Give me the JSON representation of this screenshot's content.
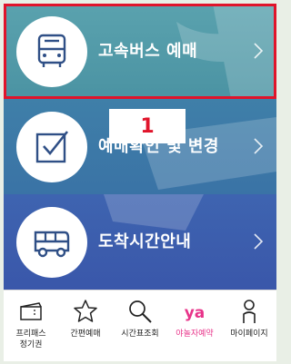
{
  "menu": {
    "items": [
      {
        "label": "고속버스 예매",
        "icon": "bus-icon"
      },
      {
        "label": "예매확인 및 변경",
        "icon": "checkbox-icon"
      },
      {
        "label": "도착시간안내",
        "icon": "bus-side-icon"
      }
    ],
    "chevron": "›"
  },
  "annotation": {
    "step_number": "1",
    "highlight_color": "#e0142b"
  },
  "tabbar": {
    "tabs": [
      {
        "label_line1": "프리패스",
        "label_line2": "정기권",
        "icon": "ticket-icon"
      },
      {
        "label_line1": "간편예매",
        "label_line2": "",
        "icon": "star-icon"
      },
      {
        "label_line1": "시간표조회",
        "label_line2": "",
        "icon": "search-icon"
      },
      {
        "label_line1": "야놀자예약",
        "label_line2": "",
        "icon": "yanolja-icon",
        "icon_text": "ya"
      },
      {
        "label_line1": "마이페이지",
        "label_line2": "",
        "icon": "person-icon"
      }
    ]
  },
  "colors": {
    "item1": "#5aa2ae",
    "item2": "#3f7fa8",
    "item3": "#3e64b0",
    "icon": "#2f4f86",
    "yanolja": "#e8348a"
  }
}
